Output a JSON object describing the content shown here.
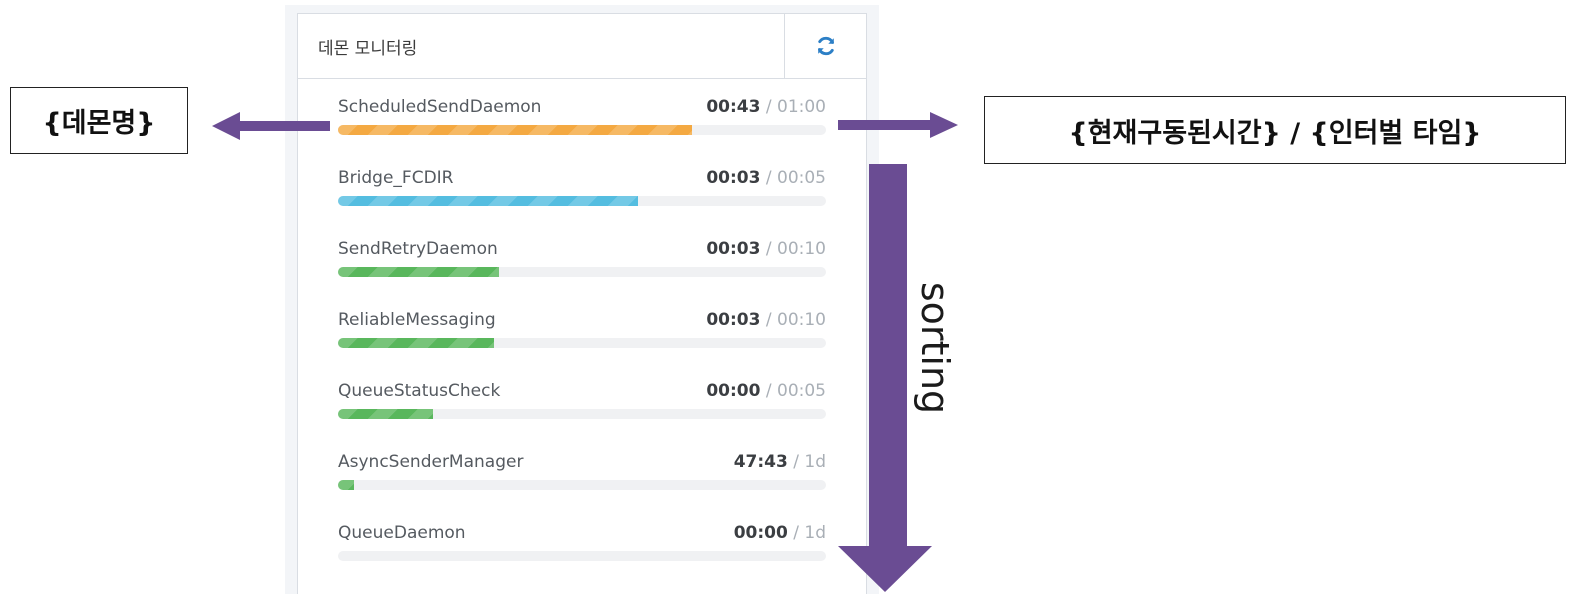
{
  "panel": {
    "title": "데몬 모니터링",
    "refresh_icon": "refresh-icon"
  },
  "daemons": [
    {
      "name": "ScheduledSendDaemon",
      "current": "00:43",
      "interval": "01:00",
      "progress": 0.725,
      "color": "#f4a942"
    },
    {
      "name": "Bridge_FCDIR",
      "current": "00:03",
      "interval": "00:05",
      "progress": 0.615,
      "color": "#54bde0"
    },
    {
      "name": "SendRetryDaemon",
      "current": "00:03",
      "interval": "00:10",
      "progress": 0.33,
      "color": "#59b75c"
    },
    {
      "name": "ReliableMessaging",
      "current": "00:03",
      "interval": "00:10",
      "progress": 0.32,
      "color": "#59b75c"
    },
    {
      "name": "QueueStatusCheck",
      "current": "00:00",
      "interval": "00:05",
      "progress": 0.195,
      "color": "#59b75c"
    },
    {
      "name": "AsyncSenderManager",
      "current": "47:43",
      "interval": "1d",
      "progress": 0.032,
      "color": "#59b75c"
    },
    {
      "name": "QueueDaemon",
      "current": "00:00",
      "interval": "1d",
      "progress": 0,
      "color": "#59b75c"
    }
  ],
  "annotations": {
    "left_label": "{데몬명}",
    "right_label": "{현재구동된시간} / {인터벌 타임}",
    "sort_label": "sorting",
    "arrow_color": "#6a4c93"
  }
}
